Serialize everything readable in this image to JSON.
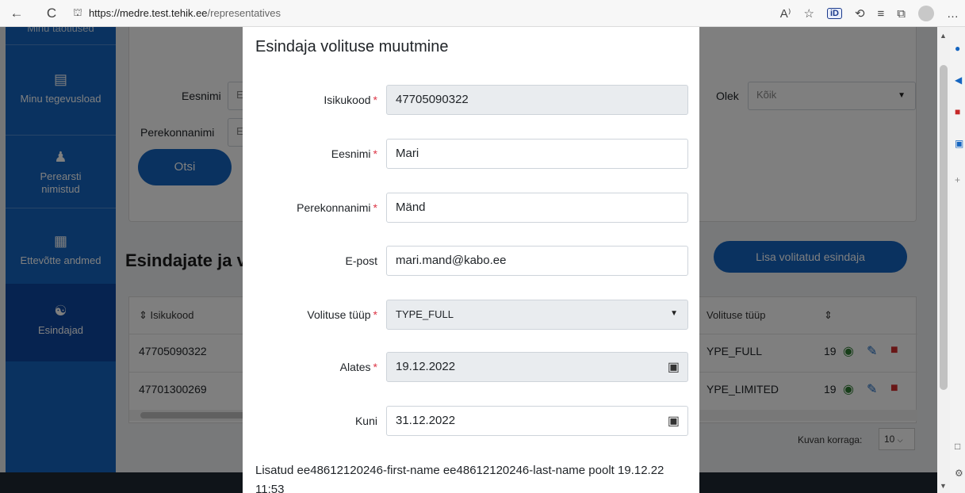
{
  "browser": {
    "back": "←",
    "reload": "C",
    "lock": "⛫",
    "url_host": "https://medre.test.tehik.ee",
    "url_path": "/representatives",
    "icons": {
      "read_aloud": "A⁾",
      "favorite": "☆",
      "id": "iD",
      "extensions": "⟲",
      "favorites_list": "≡",
      "collections": "⧉",
      "more": "…"
    }
  },
  "sidebar": {
    "items": [
      {
        "label": "Minu taotlused",
        "icon": "document-icon"
      },
      {
        "label": "Minu tegevusload",
        "icon": "list-check-icon"
      },
      {
        "label": "Perearsti nimistud",
        "icon": "doctor-icon"
      },
      {
        "label": "Ettevõtte andmed",
        "icon": "building-icon"
      },
      {
        "label": "Esindajad",
        "icon": "people-icon"
      }
    ]
  },
  "filters": {
    "eesnimi_label": "Eesnimi",
    "perekonnanimi_label": "Perekonnanimi",
    "eesnimi_placeholder": "E",
    "perekonnanimi_placeholder": "E",
    "olek_label": "Olek",
    "olek_value": "Kõik",
    "search_button": "Otsi"
  },
  "section": {
    "title": "Esindajate ja v",
    "add_button": "Lisa volitatud esindaja"
  },
  "table": {
    "headers": {
      "isikukood": "⇕ Isikukood",
      "volituse_tyyp": "Volituse tüüp",
      "sort": "⇕"
    },
    "rows": [
      {
        "isikukood": "47705090322",
        "tyyp": "YPE_FULL",
        "date": "19"
      },
      {
        "isikukood": "47701300269",
        "tyyp": "YPE_LIMITED",
        "date": "19"
      }
    ]
  },
  "pagination": {
    "label": "Kuvan korraga:",
    "value": "10"
  },
  "modal": {
    "title": "Esindaja volituse muutmine",
    "fields": {
      "isikukood": {
        "label": "Isikukood",
        "value": "47705090322"
      },
      "eesnimi": {
        "label": "Eesnimi",
        "value": "Mari"
      },
      "perekonnanimi": {
        "label": "Perekonnanimi",
        "value": "Mänd"
      },
      "epost": {
        "label": "E-post",
        "value": "mari.mand@kabo.ee"
      },
      "volituse_tyyp": {
        "label": "Volituse tüüp",
        "value": "TYPE_FULL"
      },
      "alates": {
        "label": "Alates",
        "value": "19.12.2022"
      },
      "kuni": {
        "label": "Kuni",
        "value": "31.12.2022"
      }
    },
    "required_mark": "*",
    "footer_text": "Lisatud ee48612120246-first-name ee48612120246-last-name poolt 19.12.22 11:53"
  }
}
